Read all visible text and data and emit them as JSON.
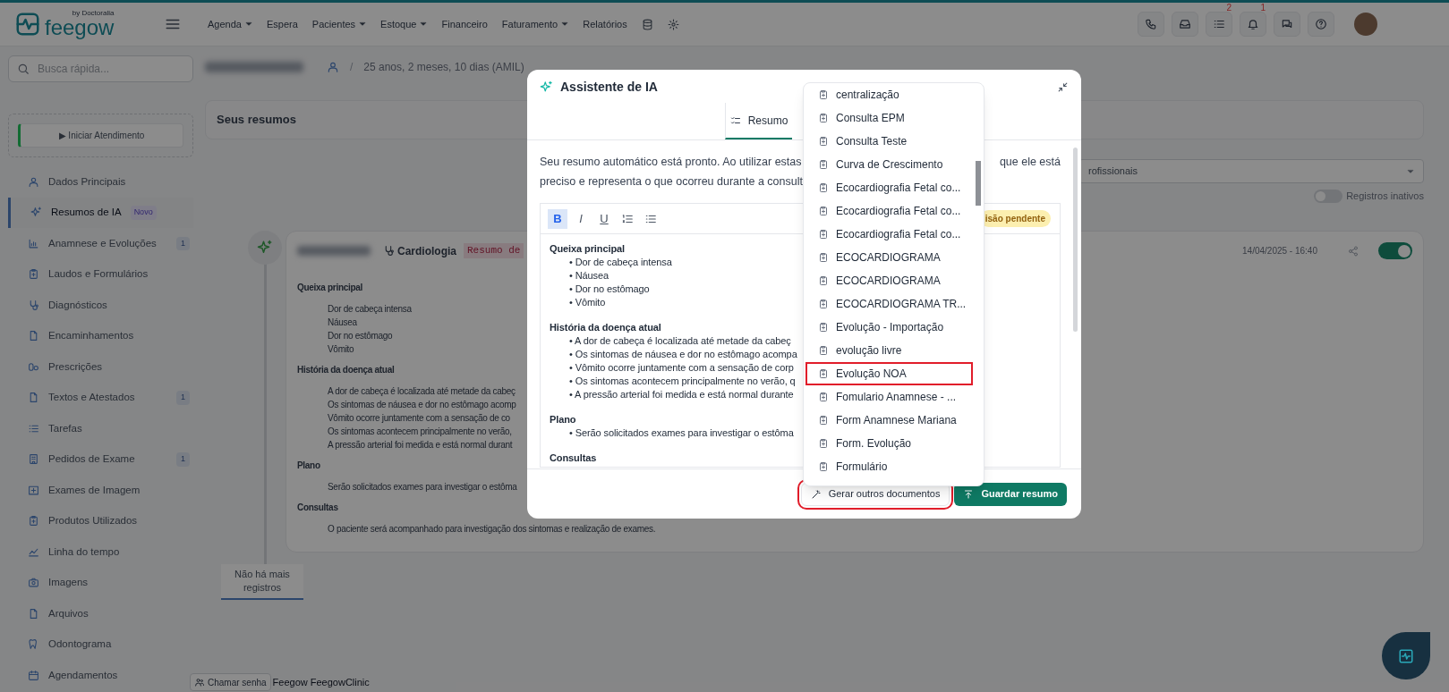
{
  "topbar": {
    "logo": "feegow",
    "logo_tag": "by Doctoralia",
    "menu": [
      {
        "label": "Agenda",
        "dropdown": true
      },
      {
        "label": "Espera",
        "dropdown": false
      },
      {
        "label": "Pacientes",
        "dropdown": true
      },
      {
        "label": "Estoque",
        "dropdown": true
      },
      {
        "label": "Financeiro",
        "dropdown": false
      },
      {
        "label": "Faturamento",
        "dropdown": true
      },
      {
        "label": "Relatórios",
        "dropdown": false
      }
    ],
    "tasks_count": "2",
    "notifications_count": "1"
  },
  "sidebar": {
    "search_placeholder": "Busca rápida...",
    "start_button": "▶ Iniciar Atendimento",
    "items": [
      {
        "label": "Dados Principais",
        "selected": false
      },
      {
        "label": "Resumos de IA",
        "selected": true,
        "tag": "Novo"
      },
      {
        "label": "Anamnese e Evoluções",
        "selected": false,
        "count": "1"
      },
      {
        "label": "Laudos e Formulários",
        "selected": false
      },
      {
        "label": "Diagnósticos",
        "selected": false
      },
      {
        "label": "Encaminhamentos",
        "selected": false
      },
      {
        "label": "Prescrições",
        "selected": false
      },
      {
        "label": "Textos e Atestados",
        "selected": false,
        "count": "1"
      },
      {
        "label": "Tarefas",
        "selected": false
      },
      {
        "label": "Pedidos de Exame",
        "selected": false,
        "count": "1"
      },
      {
        "label": "Exames de Imagem",
        "selected": false
      },
      {
        "label": "Produtos Utilizados",
        "selected": false
      },
      {
        "label": "Linha do tempo",
        "selected": false
      },
      {
        "label": "Imagens",
        "selected": false
      },
      {
        "label": "Arquivos",
        "selected": false
      },
      {
        "label": "Odontograma",
        "selected": false
      },
      {
        "label": "Agendamentos",
        "selected": false
      }
    ]
  },
  "patient": {
    "separator": "/",
    "age": "25 anos, 2 meses, 10 dias (AMIL)"
  },
  "summaries": {
    "title": "Seus resumos",
    "filter": "rofissionais",
    "inactive_label": "Registros inativos",
    "inactive_on": false,
    "card": {
      "specialty": "Cardiologia",
      "badge": "Resumo de",
      "date": "14/04/2025 - 16:40",
      "active": true,
      "sections": [
        {
          "heading": "Queixa principal",
          "items": [
            "Dor de cabeça intensa",
            "Náusea",
            "Dor no estômago",
            "Vômito"
          ]
        },
        {
          "heading": "História da doença atual",
          "items": [
            "A dor de cabeça é localizada até metade da cabeç",
            "Os sintomas de náusea e dor no estômago acomp",
            "Vômito ocorre juntamente com a sensação de co",
            "Os sintomas acontecem principalmente no verão,",
            "A pressão arterial foi medida e está normal durant"
          ]
        },
        {
          "heading": "Plano",
          "items": [
            "Serão solicitados exames para investigar o estôma"
          ]
        },
        {
          "heading": "Consultas",
          "items": [
            "O paciente será acompanhado para investigação dos sintomas e realização de exames."
          ]
        }
      ]
    },
    "end_label": "Não há mais registros"
  },
  "footer": {
    "call_button": "Chamar senha",
    "clinic": "Feegow FeegowClinic"
  },
  "modal": {
    "title": "Assistente de IA",
    "tabs": [
      {
        "label": "Resumo",
        "selected": true
      }
    ],
    "intro_start": "Seu resumo automático está pronto. Ao utilizar estas",
    "intro_end": "que ele está",
    "intro_line2": "preciso e representa o que ocorreu durante a consult",
    "format_buttons": [
      {
        "label": "B",
        "active": true
      },
      {
        "label": "I",
        "active": false
      },
      {
        "label": "U",
        "active": false
      }
    ],
    "status_badge": "isão pendente",
    "sections": [
      {
        "heading": "Queixa principal",
        "items": [
          "• Dor de cabeça intensa",
          "• Náusea",
          "• Dor no estômago",
          "• Vômito"
        ]
      },
      {
        "heading": "História da doença atual",
        "items": [
          "• A dor de cabeça é localizada até metade da cabeç",
          "• Os sintomas de náusea e dor no estômago acompa",
          "• Vômito ocorre juntamente com a sensação de corp",
          "• Os sintomas acontecem principalmente no verão, q",
          "• A pressão arterial foi medida e está normal durante"
        ]
      },
      {
        "heading": "Plano",
        "items": [
          "• Serão solicitados exames para investigar o estôma"
        ]
      },
      {
        "heading": "Consultas"
      }
    ],
    "actions": [
      {
        "label": "Gerar outros documentos",
        "kind": "secondary",
        "highlighted": true
      },
      {
        "label": "Guardar resumo",
        "kind": "primary",
        "highlighted": false
      }
    ]
  },
  "document_menu": {
    "items": [
      {
        "label": "centralização",
        "highlighted": false
      },
      {
        "label": "Consulta EPM",
        "highlighted": false
      },
      {
        "label": "Consulta Teste",
        "highlighted": false
      },
      {
        "label": "Curva de Crescimento",
        "highlighted": false
      },
      {
        "label": "Ecocardiografia Fetal co...",
        "highlighted": false
      },
      {
        "label": "Ecocardiografia Fetal co...",
        "highlighted": false
      },
      {
        "label": "Ecocardiografia Fetal co...",
        "highlighted": false
      },
      {
        "label": "ECOCARDIOGRAMA",
        "highlighted": false
      },
      {
        "label": "ECOCARDIOGRAMA",
        "highlighted": false
      },
      {
        "label": "ECOCARDIOGRAMA TR...",
        "highlighted": false
      },
      {
        "label": "Evolução - Importação",
        "highlighted": false
      },
      {
        "label": "evolução livre",
        "highlighted": false
      },
      {
        "label": "Evolução NOA",
        "highlighted": true
      },
      {
        "label": "Fomulario Anamnese - ...",
        "highlighted": false
      },
      {
        "label": "Form Anamnese Mariana",
        "highlighted": false
      },
      {
        "label": "Form. Evolução",
        "highlighted": false
      },
      {
        "label": "Formulário",
        "highlighted": false
      }
    ]
  }
}
